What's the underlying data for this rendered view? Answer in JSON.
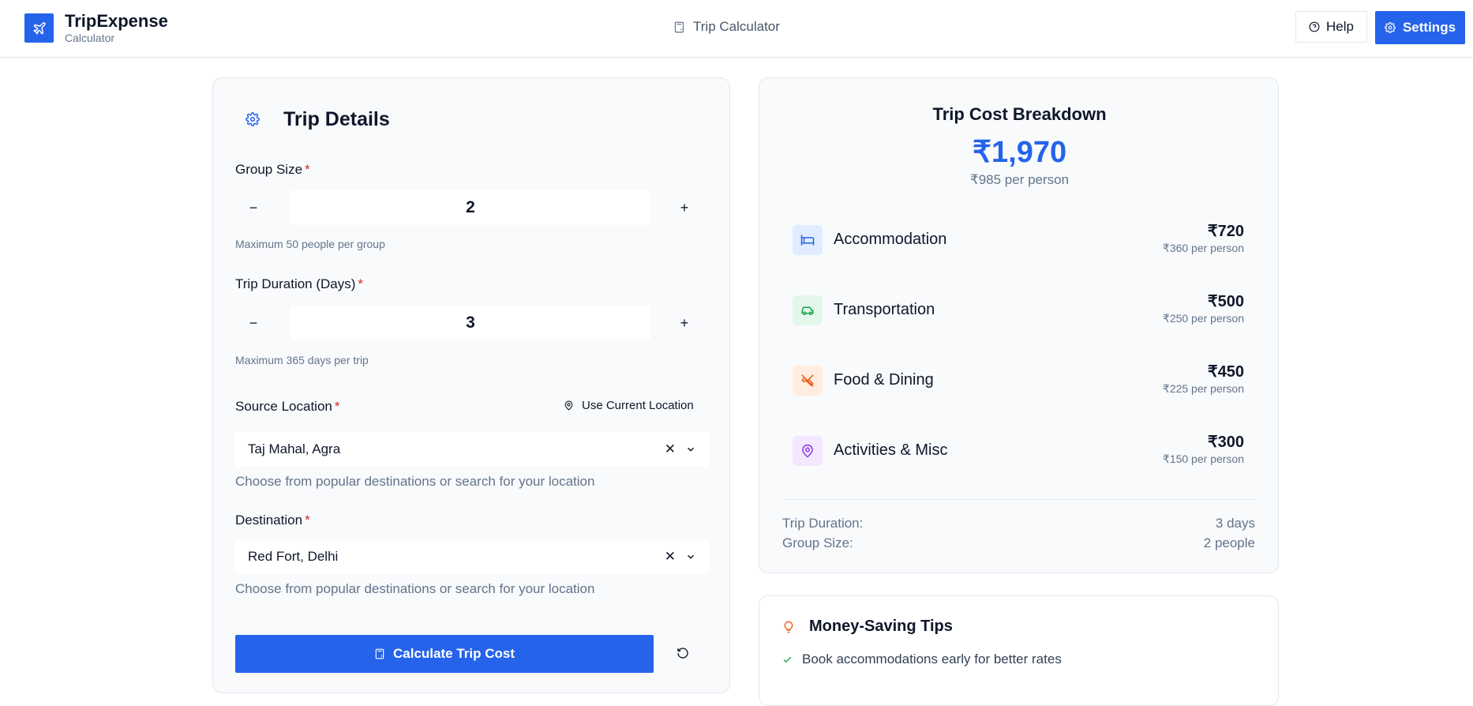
{
  "header": {
    "brand_title": "TripExpense",
    "brand_subtitle": "Calculator",
    "nav_label": "Trip Calculator",
    "help_label": "Help",
    "settings_label": "Settings"
  },
  "trip_details": {
    "title": "Trip Details",
    "group_size": {
      "label": "Group Size",
      "required": "*",
      "value": "2",
      "minus": "−",
      "plus": "+",
      "hint": "Maximum 50 people per group"
    },
    "duration": {
      "label": "Trip Duration (Days)",
      "required": "*",
      "value": "3",
      "minus": "−",
      "plus": "+",
      "hint": "Maximum 365 days per trip"
    },
    "source": {
      "label": "Source Location",
      "required": "*",
      "use_current": "Use Current Location",
      "value": "Taj Mahal, Agra",
      "hint": "Choose from popular destinations or search for your location"
    },
    "destination": {
      "label": "Destination",
      "required": "*",
      "value": "Red Fort, Delhi",
      "hint": "Choose from popular destinations or search for your location"
    },
    "calculate_label": "Calculate Trip Cost"
  },
  "breakdown": {
    "title": "Trip Cost Breakdown",
    "total": "₹1,970",
    "per_person": "₹985 per person",
    "items": [
      {
        "name": "Accommodation",
        "amount": "₹720",
        "per_person": "₹360 per person",
        "icon": "bed-icon",
        "color": "#2563eb",
        "bg": "#e0ecff"
      },
      {
        "name": "Transportation",
        "amount": "₹500",
        "per_person": "₹250 per person",
        "icon": "car-icon",
        "color": "#16a34a",
        "bg": "#e3f7ea"
      },
      {
        "name": "Food & Dining",
        "amount": "₹450",
        "per_person": "₹225 per person",
        "icon": "utensils-icon",
        "color": "#ea580c",
        "bg": "#ffede0"
      },
      {
        "name": "Activities & Misc",
        "amount": "₹300",
        "per_person": "₹150 per person",
        "icon": "map-pin-icon",
        "color": "#9333ea",
        "bg": "#f3e8ff"
      }
    ],
    "duration_label": "Trip Duration:",
    "duration_value": "3 days",
    "group_label": "Group Size:",
    "group_value": "2 people"
  },
  "tips": {
    "title": "Money-Saving Tips",
    "items": [
      "Book accommodations early for better rates"
    ]
  }
}
